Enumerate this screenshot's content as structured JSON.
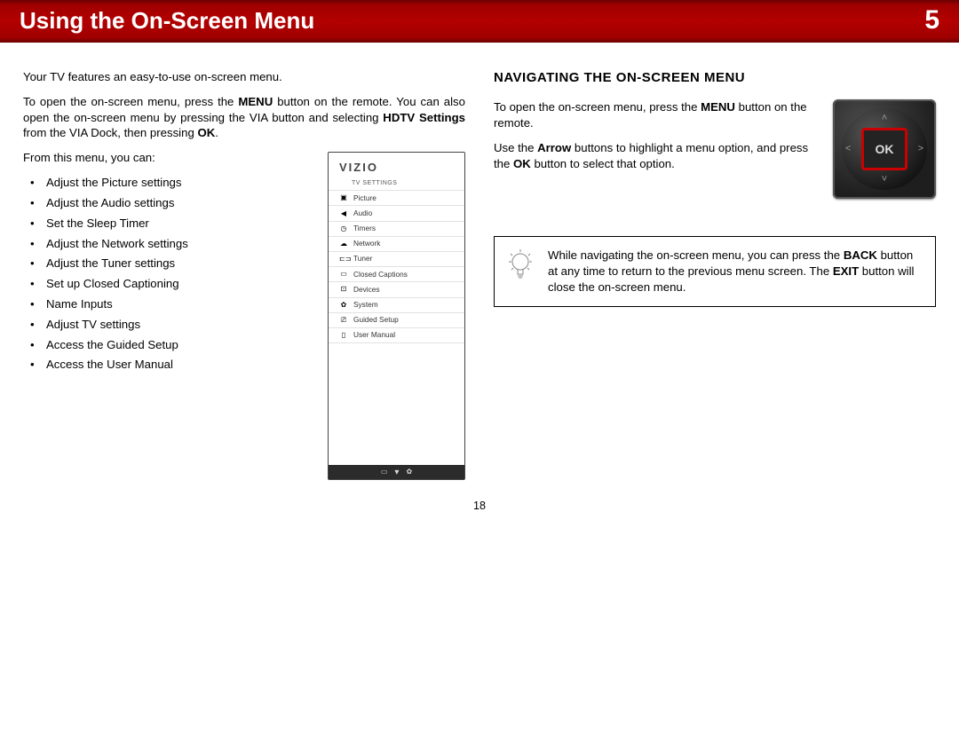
{
  "header": {
    "title": "Using the On-Screen Menu",
    "chapter": "5"
  },
  "left": {
    "p1": "Your TV features an easy-to-use on-screen menu.",
    "p2_pre": "To open the on-screen menu, press the ",
    "p2_b1": "MENU",
    "p2_mid": " button on the remote. You can also open the on-screen menu by pressing the VIA button and selecting ",
    "p2_b2": "HDTV Settings",
    "p2_mid2": " from the VIA Dock, then pressing ",
    "p2_b3": "OK",
    "p2_end": ".",
    "p3": "From this menu, you can:",
    "actions": [
      "Adjust the Picture settings",
      "Adjust the Audio settings",
      "Set the Sleep Timer",
      "Adjust the Network settings",
      "Adjust the Tuner settings",
      "Set up Closed Captioning",
      "Name Inputs",
      "Adjust TV settings",
      "Access the Guided Setup",
      "Access the User Manual"
    ]
  },
  "mock_menu": {
    "brand": "VIZIO",
    "subhead": "TV SETTINGS",
    "items": [
      {
        "icon": "▣",
        "label": "Picture",
        "name": "picture-icon"
      },
      {
        "icon": "◀",
        "label": "Audio",
        "name": "speaker-icon"
      },
      {
        "icon": "◷",
        "label": "Timers",
        "name": "clock-icon"
      },
      {
        "icon": "☁",
        "label": "Network",
        "name": "network-icon"
      },
      {
        "icon": "⊏⊐",
        "label": "Tuner",
        "name": "tuner-icon"
      },
      {
        "icon": "▭",
        "label": "Closed Captions",
        "name": "cc-icon"
      },
      {
        "icon": "⊡",
        "label": "Devices",
        "name": "devices-icon"
      },
      {
        "icon": "✿",
        "label": "System",
        "name": "gear-icon"
      },
      {
        "icon": "⎚",
        "label": "Guided Setup",
        "name": "guided-icon"
      },
      {
        "icon": "▯",
        "label": "User Manual",
        "name": "manual-icon"
      }
    ]
  },
  "right": {
    "heading": "NAVIGATING THE ON-SCREEN MENU",
    "p1_pre": "To open the on-screen menu, press the ",
    "p1_b1": "MENU",
    "p1_end": " button on the remote.",
    "p2_pre": "Use the ",
    "p2_b1": "Arrow",
    "p2_mid": " buttons to highlight a menu option, and press the ",
    "p2_b2": "OK",
    "p2_end": " button to select that option.",
    "ok_label": "OK"
  },
  "tip": {
    "pre": "While navigating the on-screen menu, you can press the ",
    "b1": "BACK",
    "mid": " button at any time to return to the previous menu screen. The ",
    "b2": "EXIT",
    "end": " button will close the on-screen menu."
  },
  "page_number": "18"
}
